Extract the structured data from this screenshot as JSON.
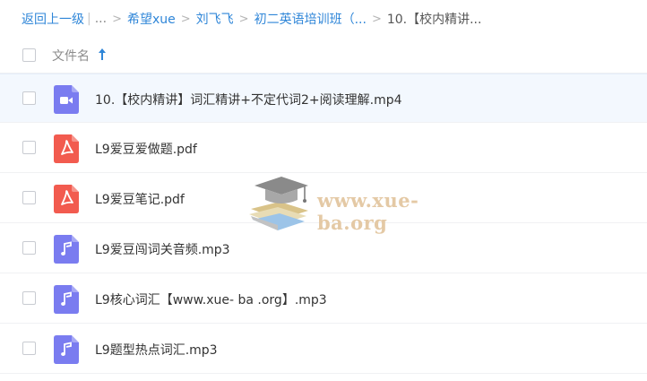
{
  "breadcrumb": {
    "back_label": "返回上一级",
    "separator_bar": "|",
    "ellipsis": "...",
    "separator": ">",
    "items": [
      "希望xue",
      "刘飞飞",
      "初二英语培训班（..."
    ],
    "current": "10.【校内精讲..."
  },
  "header": {
    "name_label": "文件名"
  },
  "files": [
    {
      "name": "10.【校内精讲】词汇精讲+不定代词2+阅读理解.mp4",
      "icon": "video-file-icon",
      "color": "#7a7cf0"
    },
    {
      "name": "L9爱豆爱做题.pdf",
      "icon": "pdf-file-icon",
      "color": "#f25b4f"
    },
    {
      "name": "L9爱豆笔记.pdf",
      "icon": "pdf-file-icon",
      "color": "#f25b4f"
    },
    {
      "name": "L9爱豆闯词关音频.mp3",
      "icon": "audio-file-icon",
      "color": "#7a7cf0"
    },
    {
      "name": "L9核心词汇【www.xue- ba .org】.mp3",
      "icon": "audio-file-icon",
      "color": "#7a7cf0"
    },
    {
      "name": "L9题型热点词汇.mp3",
      "icon": "audio-file-icon",
      "color": "#7a7cf0"
    }
  ],
  "watermark": {
    "text": "www.xue-ba.org"
  },
  "colors": {
    "link": "#2f86d8",
    "hover_row": "#f3f8fe"
  }
}
